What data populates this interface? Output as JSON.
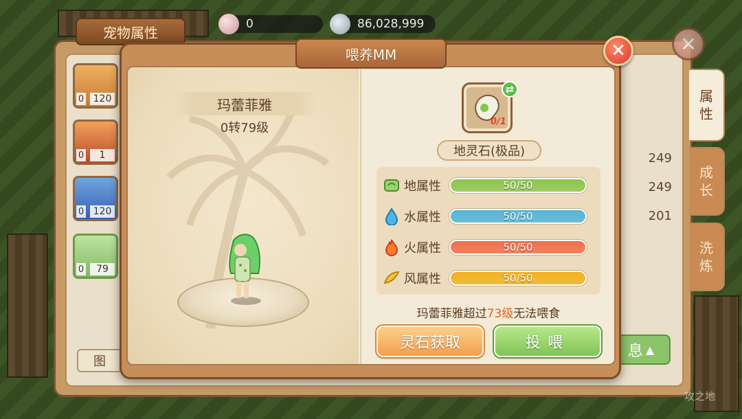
{
  "background_panel": {
    "title": "宠物属性",
    "side_tabs": [
      "属\n性",
      "成\n长",
      "洗\n炼"
    ],
    "pet_list": [
      {
        "badge": "0",
        "level": "120"
      },
      {
        "badge": "0",
        "level": "1"
      },
      {
        "badge": "0",
        "level": "120"
      },
      {
        "badge": "0",
        "level": "79"
      }
    ],
    "stat_values": [
      "249",
      "249",
      "201"
    ],
    "info_button": "息",
    "map_button": "图"
  },
  "resources": {
    "pearl": "0",
    "silver": "86,028,999"
  },
  "dialog": {
    "title": "喂养MM",
    "pet_name": "玛蕾菲雅",
    "pet_level": "0转79级",
    "item_name": "地灵石(极品)",
    "item_quantity": "0/1",
    "attributes": [
      {
        "label": "地属性",
        "value": "50/50",
        "fraction": 1.0,
        "color": "#8cc64f",
        "icon": "earth-icon"
      },
      {
        "label": "水属性",
        "value": "50/50",
        "fraction": 1.0,
        "color": "#52b5d9",
        "icon": "water-icon"
      },
      {
        "label": "火属性",
        "value": "50/50",
        "fraction": 1.0,
        "color": "#f26d4a",
        "icon": "fire-icon"
      },
      {
        "label": "风属性",
        "value": "50/50",
        "fraction": 1.0,
        "color": "#f2b21e",
        "icon": "wind-icon"
      }
    ],
    "warning_prefix": "玛蕾菲雅超过",
    "warning_level": "73级",
    "warning_suffix": "无法喂食",
    "obtain_button": "灵石获取",
    "feed_button": "投喂"
  },
  "watermark": "攻之地"
}
